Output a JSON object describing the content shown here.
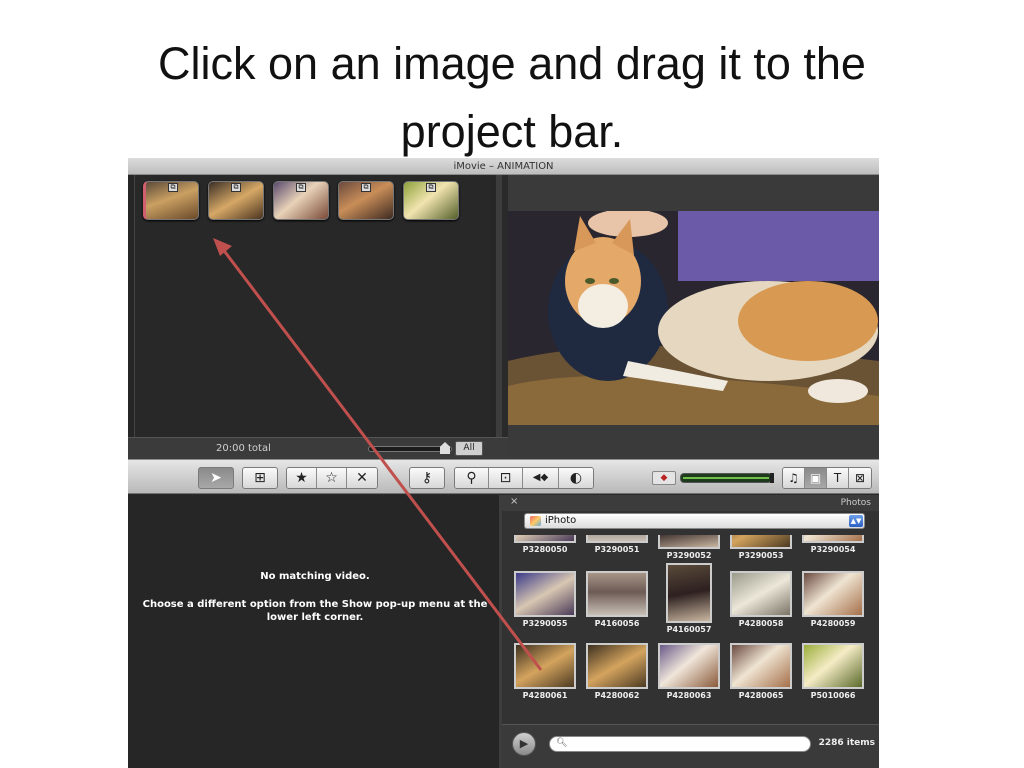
{
  "slide": {
    "title_line1": "Click on an image and drag it to the",
    "title_line2": "project bar."
  },
  "window": {
    "title": "iMovie – ANIMATION"
  },
  "project": {
    "total_label": "20:00 total",
    "all_button": "All",
    "clips": [
      {
        "badge": "⧉"
      },
      {
        "badge": "⧉"
      },
      {
        "badge": "⧉"
      },
      {
        "badge": "⧉"
      },
      {
        "badge": "⧉"
      }
    ]
  },
  "toolbar": {
    "arrow_icon": "➤",
    "add_icon": "⊞",
    "star_filled": "★",
    "star_empty": "☆",
    "reject": "✕",
    "keyword": "⚷",
    "voiceover": "⚲",
    "crop": "⊡",
    "audio": "◀◆",
    "color": "◐",
    "music_icon": "♫",
    "photo_icon": "▣",
    "title_icon": "T",
    "transition_icon": "⊠"
  },
  "event": {
    "no_match": "No matching video.",
    "hint": "Choose a different option from the Show pop-up menu at the lower left corner."
  },
  "photos": {
    "header_label": "Photos",
    "close": "×",
    "source": "iPhoto",
    "search_icon": "🔍︎",
    "item_count": "2286 items",
    "top_row": [
      "P3280050",
      "P3290051",
      "P3290052",
      "P3290053",
      "P3290054"
    ],
    "middle_row": [
      "P3290055",
      "P4160056",
      "P4160057",
      "P4280058",
      "P4280059"
    ],
    "bottom_row": [
      "P4280061",
      "P4280062",
      "P4280063",
      "P4280065",
      "P5010066"
    ]
  }
}
